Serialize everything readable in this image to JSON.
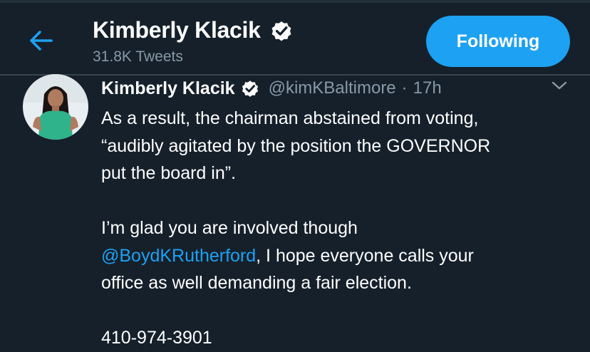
{
  "header": {
    "back_icon": "arrow-left-icon",
    "title": "Kimberly Klacik",
    "verified_icon": "verified-badge-icon",
    "tweet_count": "31.8K Tweets",
    "follow_label": "Following"
  },
  "tweet": {
    "avatar_icon": "profile-photo",
    "author": "Kimberly Klacik",
    "handle": "@kimKBaltimore",
    "separator": "·",
    "time": "17h",
    "menu_icon": "chevron-down-icon",
    "text": {
      "p1_l1": "As a result, the chairman abstained from voting,",
      "p1_l2": "“audibly agitated by the position the GOVERNOR",
      "p1_l3": "put the board in”.",
      "p2_l1": "I’m glad you are involved though",
      "mention": "@BoydKRutherford",
      "p2_l2_rest": ", I hope everyone calls your",
      "p2_l3": "office as well demanding a fair election.",
      "phone": "410-974-3901"
    }
  },
  "colors": {
    "background": "#15202b",
    "accent": "#1da1f2",
    "secondary_text": "#8899a6",
    "divider": "#38444d"
  }
}
